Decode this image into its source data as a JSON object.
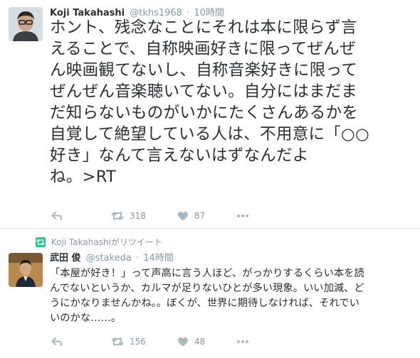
{
  "tweet1": {
    "name": "Koji Takahashi",
    "handle": "@tkhs1968",
    "sep": "·",
    "time": "10時間",
    "text": "ホント、残念なことにそれは本に限らず言\nえることで、自称映画好きに限ってぜんぜ\nん映画観てないし、自称音楽好きに限って\nぜんぜん音楽聴いてない。自分にはまだま\nだ知らないものがいかにたくさんあるかを\n自覚して絶望している人は、不用意に「○○\n好き」なんて言えないはずなんだよ\nね。>RT",
    "retweets": "318",
    "likes": "87"
  },
  "tweet2": {
    "retweeted_by": "Koji Takahashiがリツイート",
    "name": "武田 俊",
    "handle": "@stakeda",
    "sep": "·",
    "time": "14時間",
    "text": "「本屋が好き！」って声高に言う人ほど、がっかりするくらい本を読\nんでないというか、カルマが足りないひとが多い現象。いい加減、ど\nうにかなりませんかね。。ぼくが、世界に期待しなければ、それでい\nいのかな……。",
    "retweets": "156",
    "likes": "48"
  },
  "colors": {
    "retweet_green": "#19cf86",
    "muted": "#8899a6",
    "icon": "#aab8c2",
    "text": "#292f33"
  },
  "icons": [
    "reply-icon",
    "retweet-icon",
    "heart-icon",
    "more-icon"
  ]
}
